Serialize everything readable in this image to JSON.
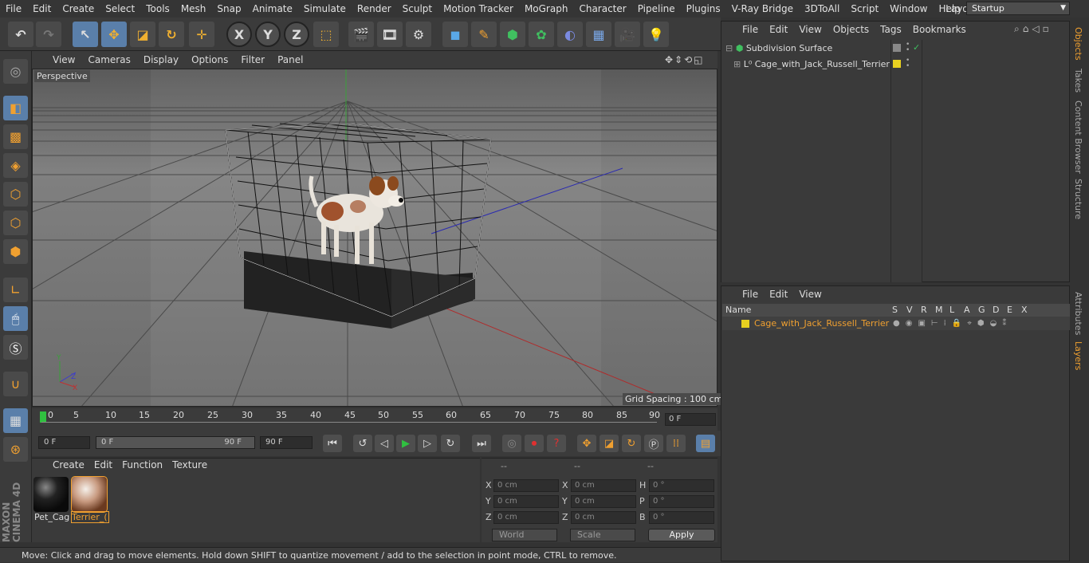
{
  "menubar": {
    "items": [
      "File",
      "Edit",
      "Create",
      "Select",
      "Tools",
      "Mesh",
      "Snap",
      "Animate",
      "Simulate",
      "Render",
      "Sculpt",
      "Motion Tracker",
      "MoGraph",
      "Character",
      "Pipeline",
      "Plugins",
      "V-Ray Bridge",
      "3DToAll",
      "Script",
      "Window",
      "Help"
    ],
    "layout_label": "Layout:",
    "layout_value": "Startup"
  },
  "toolbar": {
    "icons": [
      "undo-icon",
      "redo-icon",
      "live-selection-icon",
      "move-icon",
      "scale-icon",
      "rotate-icon",
      "recent-tool-icon",
      "x-axis-icon",
      "y-axis-icon",
      "z-axis-icon",
      "world-coordinates-icon",
      "render-view-icon",
      "render-picture-viewer-icon",
      "edit-render-settings-icon",
      "cube-icon",
      "pen-icon",
      "subdivision-icon",
      "cloner-icon",
      "deformer-icon",
      "floor-icon",
      "camera-icon",
      "light-icon"
    ],
    "axis_labels": [
      "X",
      "Y",
      "Z"
    ]
  },
  "viewport": {
    "menu": [
      "View",
      "Cameras",
      "Display",
      "Options",
      "Filter",
      "Panel"
    ],
    "label": "Perspective",
    "grid_spacing": "Grid Spacing : 100 cm"
  },
  "timeline": {
    "ticks": [
      "0",
      "5",
      "10",
      "15",
      "20",
      "25",
      "30",
      "35",
      "40",
      "45",
      "50",
      "55",
      "60",
      "65",
      "70",
      "75",
      "80",
      "85",
      "90"
    ],
    "current_frame": "0 F",
    "start_field": "0 F",
    "range_start": "0 F",
    "range_end": "90 F",
    "end_field": "90 F"
  },
  "material_manager": {
    "menu": [
      "Create",
      "Edit",
      "Function",
      "Texture"
    ],
    "materials": [
      {
        "label": "Pet_Cag"
      },
      {
        "label": "Terrier_("
      }
    ]
  },
  "coordinates": {
    "headers": [
      "--",
      "--",
      "--"
    ],
    "rows": [
      {
        "pos_label": "X",
        "pos": "0 cm",
        "size_label": "X",
        "size": "0 cm",
        "rot_label": "H",
        "rot": "0 °"
      },
      {
        "pos_label": "Y",
        "pos": "0 cm",
        "size_label": "Y",
        "size": "0 cm",
        "rot_label": "P",
        "rot": "0 °"
      },
      {
        "pos_label": "Z",
        "pos": "0 cm",
        "size_label": "Z",
        "size": "0 cm",
        "rot_label": "B",
        "rot": "0 °"
      }
    ],
    "mode": "World",
    "size_mode": "Scale",
    "apply": "Apply"
  },
  "status": "Move: Click and drag to move elements. Hold down SHIFT to quantize movement / add to the selection in point mode, CTRL to remove.",
  "object_manager": {
    "menu": [
      "File",
      "Edit",
      "View",
      "Objects",
      "Tags",
      "Bookmarks"
    ],
    "objects": [
      "Subdivision Surface",
      "Cage_with_Jack_Russell_Terrier"
    ]
  },
  "layer_manager": {
    "menu": [
      "File",
      "Edit",
      "View"
    ],
    "header": {
      "name": "Name",
      "cols": [
        "S",
        "V",
        "R",
        "M",
        "L",
        "A",
        "G",
        "D",
        "E",
        "X"
      ]
    },
    "layers": [
      "Cage_with_Jack_Russell_Terrier"
    ]
  },
  "side_tabs": [
    "Objects",
    "Takes",
    "Content Browser",
    "Structure",
    "Attributes",
    "Layers"
  ],
  "branding": "MAXON CINEMA 4D",
  "colors": {
    "accent": "#f0a030",
    "selection": "#5a7faa",
    "layer_color": "#e8d020"
  }
}
